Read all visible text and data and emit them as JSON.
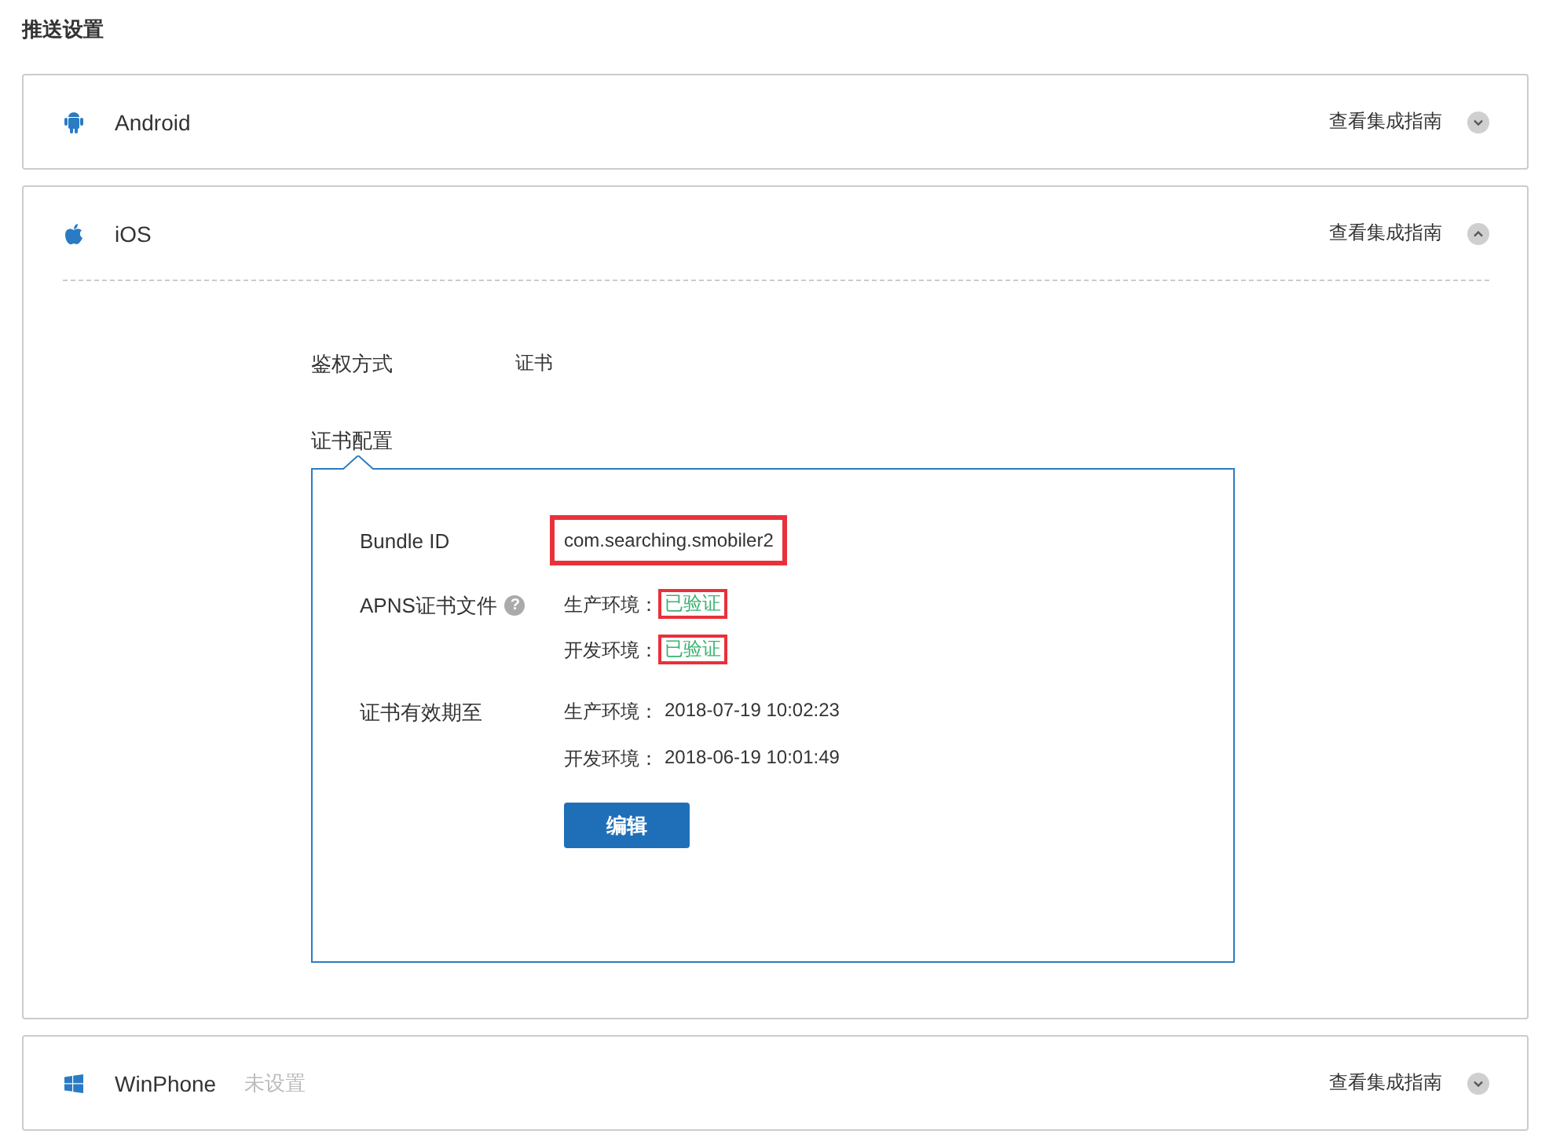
{
  "page_title": "推送设置",
  "panels": [
    {
      "kind": "android",
      "name": "Android",
      "guide_link": "查看集成指南",
      "expanded": false
    },
    {
      "kind": "apple",
      "name": "iOS",
      "guide_link": "查看集成指南",
      "expanded": true,
      "auth": {
        "label": "鉴权方式",
        "value": "证书"
      },
      "config": {
        "title": "证书配置",
        "bundle": {
          "label": "Bundle ID",
          "value": "com.searching.smobiler2",
          "highlighted": true
        },
        "apns": {
          "label": "APNS证书文件",
          "help": "?",
          "rows": [
            {
              "label": "生产环境：",
              "value": "已验证",
              "highlighted": true
            },
            {
              "label": "开发环境：",
              "value": "已验证",
              "highlighted": true
            }
          ]
        },
        "validity": {
          "label": "证书有效期至",
          "rows": [
            {
              "label": "生产环境：",
              "value": "2018-07-19 10:02:23"
            },
            {
              "label": "开发环境：",
              "value": "2018-06-19 10:01:49"
            }
          ]
        },
        "edit_button": "编辑"
      }
    },
    {
      "kind": "windows",
      "name": "WinPhone",
      "status": "未设置",
      "guide_link": "查看集成指南",
      "expanded": false
    }
  ]
}
